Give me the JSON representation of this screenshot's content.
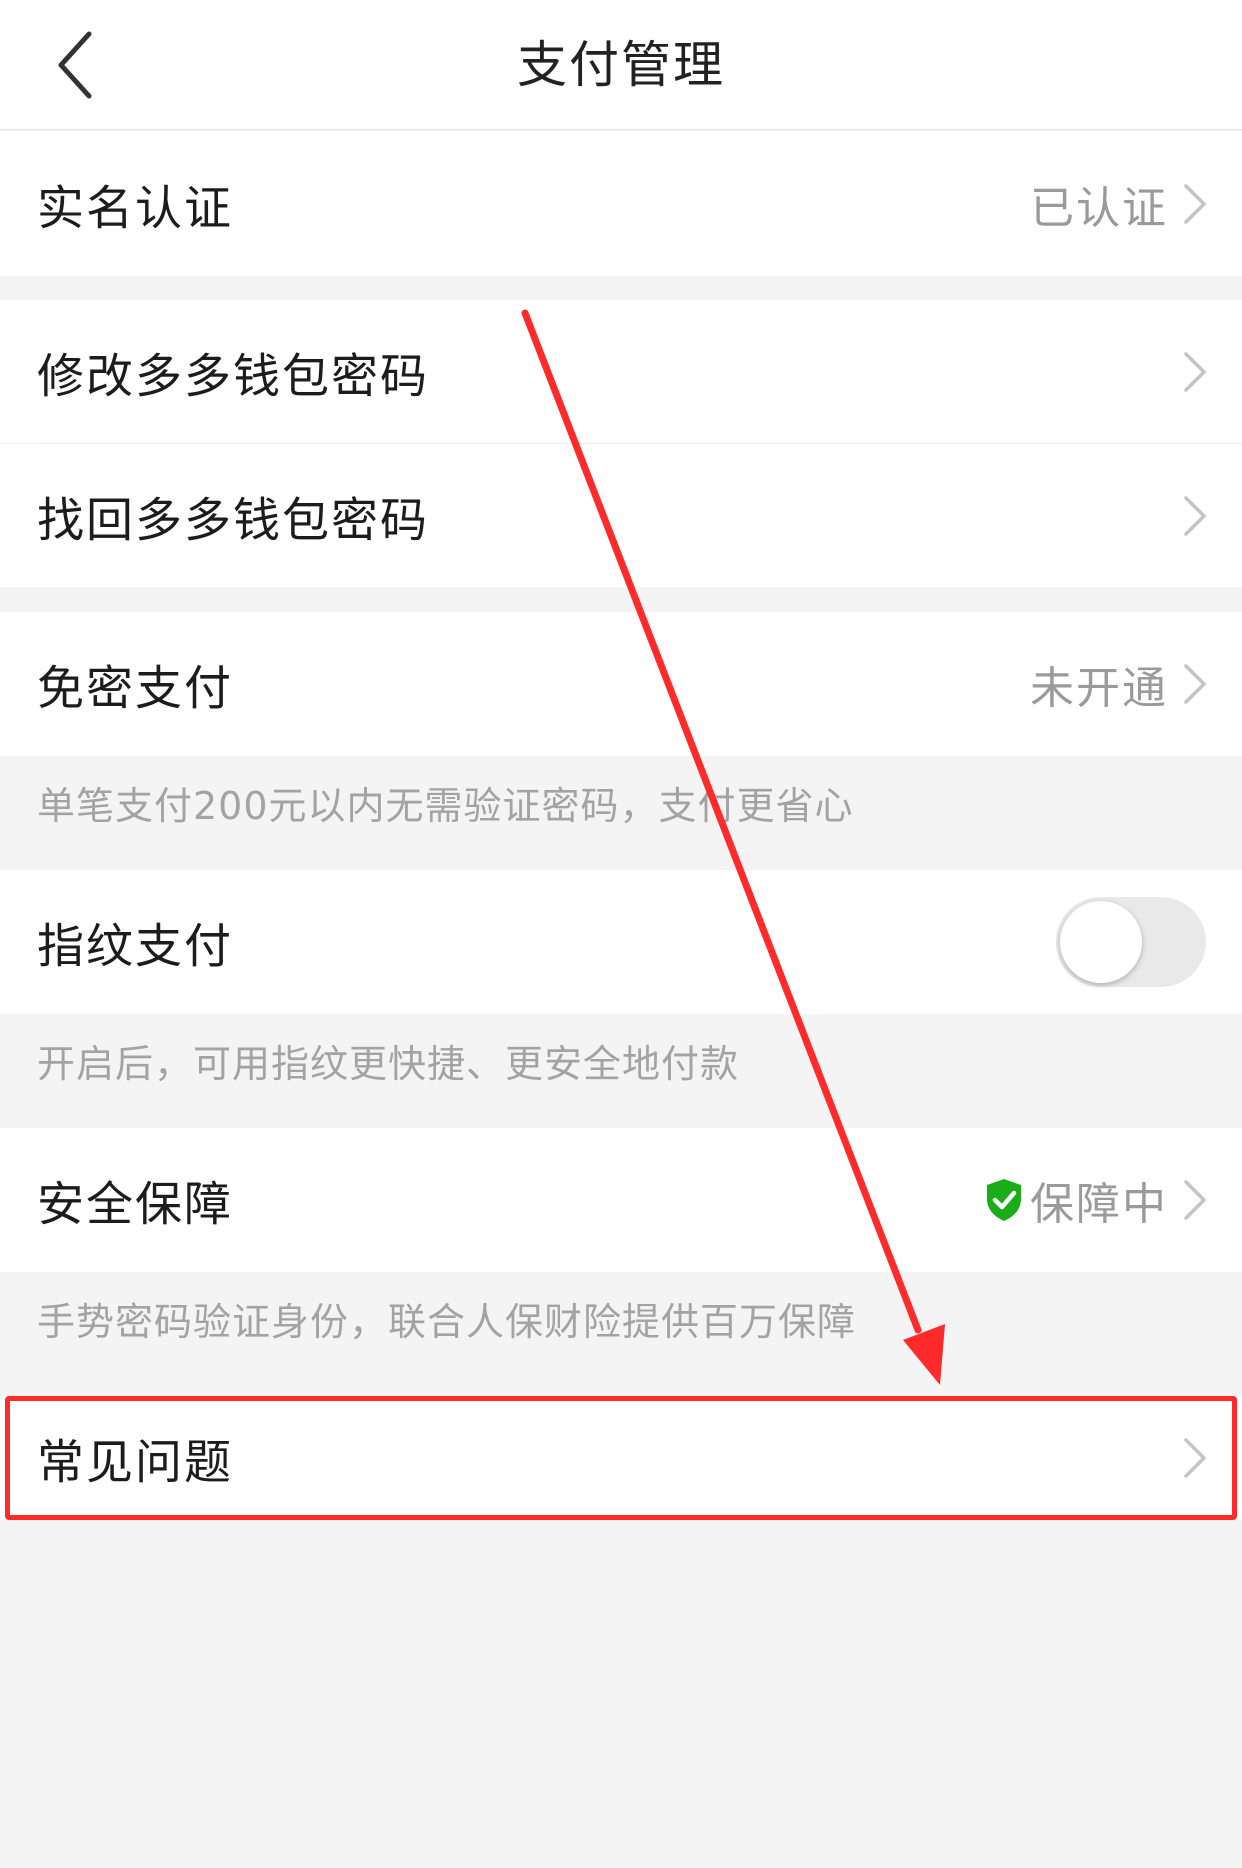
{
  "header": {
    "title": "支付管理",
    "back_icon": "chevron-left-icon"
  },
  "rows": {
    "realname": {
      "label": "实名认证",
      "value": "已认证"
    },
    "change_pwd": {
      "label": "修改多多钱包密码"
    },
    "recover_pwd": {
      "label": "找回多多钱包密码"
    },
    "nopwd_pay": {
      "label": "免密支付",
      "value": "未开通",
      "hint": "单笔支付200元以内无需验证密码，支付更省心"
    },
    "fingerprint": {
      "label": "指纹支付",
      "toggle_on": false,
      "hint": "开启后，可用指纹更快捷、更安全地付款"
    },
    "security": {
      "label": "安全保障",
      "value": "保障中",
      "icon": "shield-check-icon",
      "hint": "手势密码验证身份，联合人保财险提供百万保障"
    },
    "faq": {
      "label": "常见问题"
    }
  },
  "colors": {
    "accent_red": "#ff2a2a",
    "shield_green": "#1aad19",
    "background": "#f4f4f4"
  }
}
